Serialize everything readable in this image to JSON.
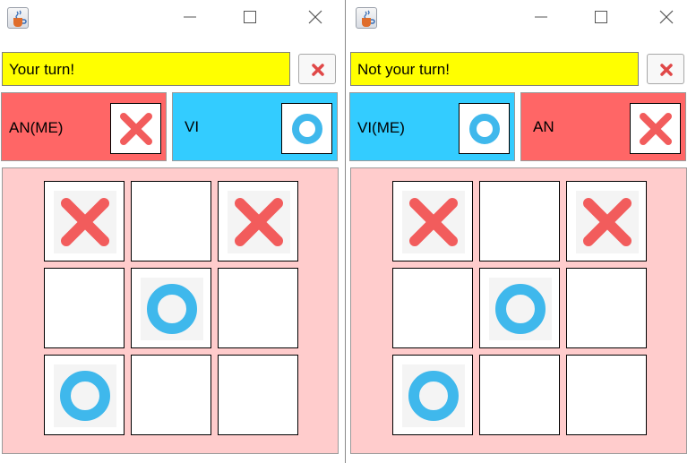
{
  "windows": [
    {
      "status_text": "Your turn!",
      "status_color": "#ffff00",
      "players": [
        {
          "name": "AN(ME)",
          "mark": "x-mark-icon",
          "color": "#ff6666"
        },
        {
          "name": "VI",
          "mark": "o-mark-icon",
          "color": "#33ccff"
        }
      ],
      "board": [
        "X",
        "",
        "X",
        "",
        "O",
        "",
        "O",
        "",
        ""
      ]
    },
    {
      "status_text": "Not your turn!",
      "status_color": "#ffff00",
      "players": [
        {
          "name": "VI(ME)",
          "mark": "o-mark-icon",
          "color": "#33ccff"
        },
        {
          "name": "AN",
          "mark": "x-mark-icon",
          "color": "#ff6666"
        }
      ],
      "board": [
        "X",
        "",
        "X",
        "",
        "O",
        "",
        "O",
        "",
        ""
      ]
    }
  ],
  "icons": {
    "app": "java-cup-icon",
    "minimize": "minimize-icon",
    "maximize": "maximize-icon",
    "close": "close-icon",
    "exit": "exit-x-icon"
  },
  "colors": {
    "board_bg": "#ffcccc",
    "x_mark": "#f25c5c",
    "o_mark": "#3fb8ec"
  }
}
